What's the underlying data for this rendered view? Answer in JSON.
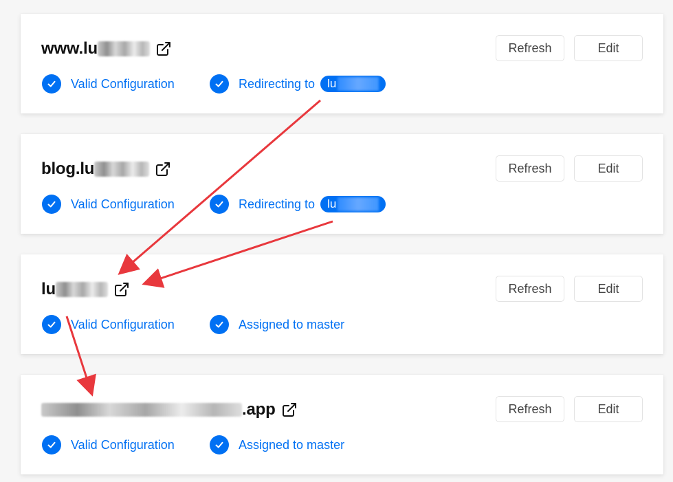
{
  "domains": [
    {
      "name_prefix": "www.lu",
      "name_suffix": "",
      "statuses": [
        {
          "label": "Valid Configuration",
          "pill_prefix": ""
        },
        {
          "label": "Redirecting to",
          "pill_prefix": "lu"
        }
      ],
      "refresh_label": "Refresh",
      "edit_label": "Edit"
    },
    {
      "name_prefix": "blog.lu",
      "name_suffix": "",
      "statuses": [
        {
          "label": "Valid Configuration",
          "pill_prefix": ""
        },
        {
          "label": "Redirecting to",
          "pill_prefix": "lu"
        }
      ],
      "refresh_label": "Refresh",
      "edit_label": "Edit"
    },
    {
      "name_prefix": "lu",
      "name_suffix": "",
      "statuses": [
        {
          "label": "Valid Configuration",
          "pill_prefix": ""
        },
        {
          "label": "Assigned to master",
          "pill_prefix": ""
        }
      ],
      "refresh_label": "Refresh",
      "edit_label": "Edit"
    },
    {
      "name_prefix": "",
      "name_suffix": ".app",
      "statuses": [
        {
          "label": "Valid Configuration",
          "pill_prefix": ""
        },
        {
          "label": "Assigned to master",
          "pill_prefix": ""
        }
      ],
      "refresh_label": "Refresh",
      "edit_label": "Edit"
    }
  ],
  "colors": {
    "accent": "#0070f3",
    "annotation_arrow": "#e8383d",
    "card_background": "#ffffff",
    "page_background": "#f6f6f6"
  },
  "icons": {
    "external_link": "external-link-icon",
    "status": "check-circle-icon"
  }
}
